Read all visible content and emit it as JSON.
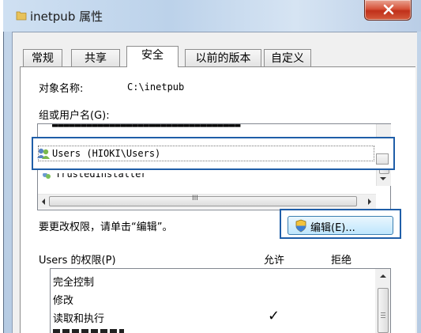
{
  "window": {
    "title": "inetpub 属性",
    "close_symbol": "X"
  },
  "tabs": [
    {
      "label": "常规",
      "active": false
    },
    {
      "label": "共享",
      "active": false
    },
    {
      "label": "安全",
      "active": true
    },
    {
      "label": "以前的版本",
      "active": false
    },
    {
      "label": "自定义",
      "active": false
    }
  ],
  "security": {
    "object_label": "对象名称:",
    "object_value": "C:\\inetpub",
    "group_label": "组或用户名(G):",
    "selected_user": "Users (HIOKI\\Users)",
    "partial_row": "TrustedInstaller",
    "change_hint": "要更改权限，请单击“编辑”。",
    "edit_button": "编辑(E)...",
    "perm_header": "Users 的权限(P)",
    "allow_header": "允许",
    "deny_header": "拒绝",
    "permissions": [
      {
        "name": "完全控制",
        "allow": false,
        "deny": false
      },
      {
        "name": "修改",
        "allow": false,
        "deny": false
      },
      {
        "name": "读取和执行",
        "allow": true,
        "deny": false
      }
    ],
    "check_mark": "✓",
    "hscroll_grip": "III"
  },
  "icons": {
    "title": "folder-icon",
    "user": "users-group-icon",
    "edit": "uac-shield-icon"
  },
  "colors": {
    "highlight_border": "#1f5ea8",
    "close_button": "#c0301a"
  }
}
